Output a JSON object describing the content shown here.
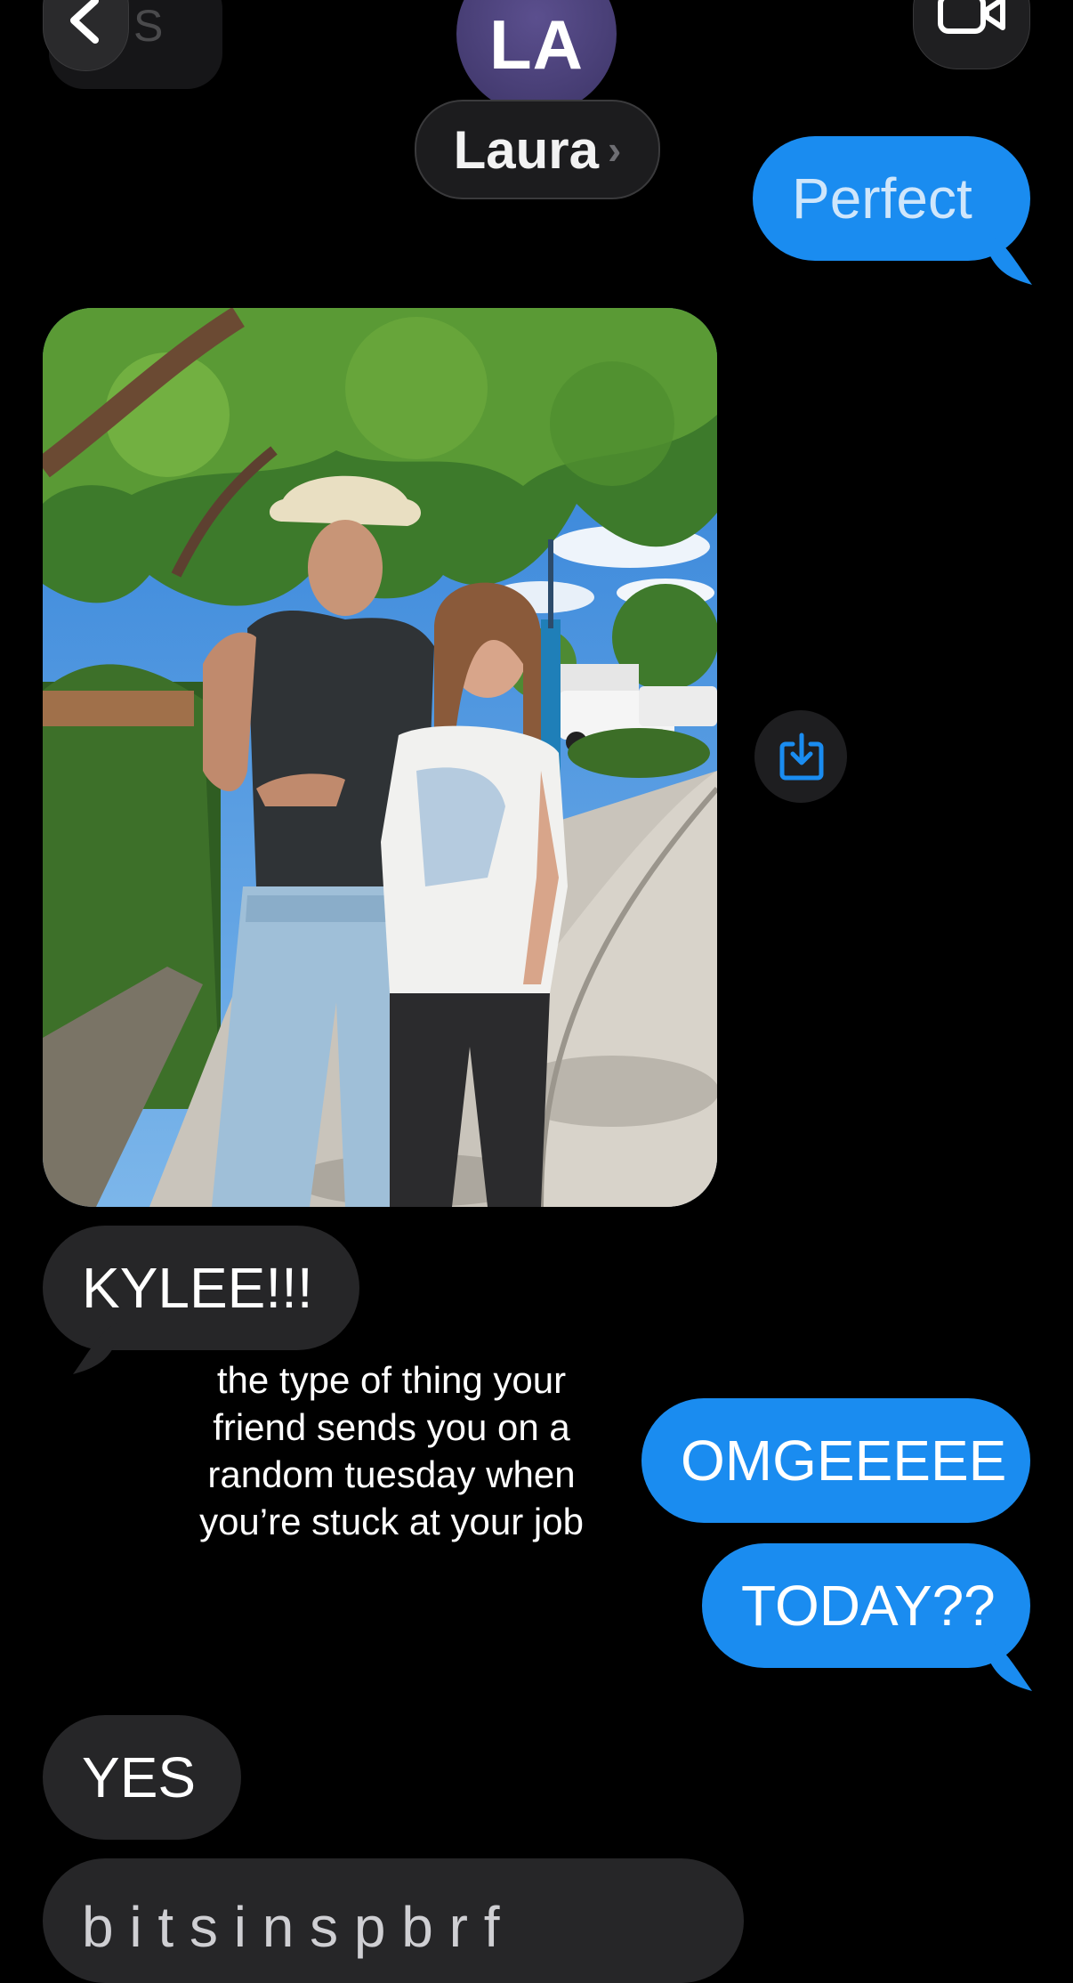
{
  "header": {
    "back_ghost_text": "S",
    "contact_initials": "LA",
    "contact_name": "Laura",
    "name_chevron": "›"
  },
  "messages": {
    "m1": "Perfect",
    "m2": "KYLEE!!!",
    "m3": "OMGEEEEE",
    "m4": "TODAY??",
    "m5": "YES",
    "m6": "b  i  t  s  i  n  s  p  b  r  f"
  },
  "overlay": {
    "text": "the type of thing your friend sends you on a random tuesday when you’re stuck at your job"
  },
  "icons": {
    "back": "chevron-left-icon",
    "video": "video-camera-icon",
    "save": "download-icon"
  },
  "colors": {
    "sent_bubble": "#1a8cf0",
    "received_bubble": "#262628",
    "avatar": "#4a4178",
    "background": "#000000"
  }
}
